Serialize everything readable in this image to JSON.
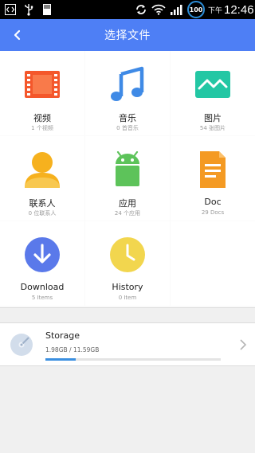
{
  "status_bar": {
    "battery_level": "100",
    "ampm": "下午",
    "time": "12:46",
    "icons": [
      "code-icon",
      "usb-icon",
      "sd-card-icon",
      "sync-icon",
      "wifi-icon",
      "signal-icon",
      "battery-icon"
    ]
  },
  "header": {
    "title": "选择文件",
    "back_icon": "back-arrow-icon",
    "color": "#4e7ff5"
  },
  "categories": [
    {
      "label": "视频",
      "count": "1 个视频",
      "icon": "video-icon",
      "color": "#f4572b"
    },
    {
      "label": "音乐",
      "count": "0 首音乐",
      "icon": "music-icon",
      "color": "#3f8ae6"
    },
    {
      "label": "图片",
      "count": "54 张图片",
      "icon": "image-icon",
      "color": "#23c7a4"
    },
    {
      "label": "联系人",
      "count": "0 位联系人",
      "icon": "contact-icon",
      "color": "#f6b11e"
    },
    {
      "label": "应用",
      "count": "24 个应用",
      "icon": "android-icon",
      "color": "#5dc35a"
    },
    {
      "label": "Doc",
      "count": "29 Docs",
      "icon": "document-icon",
      "color": "#f49a23"
    },
    {
      "label": "Download",
      "count": "5 Items",
      "icon": "download-icon",
      "color": "#5a79ea"
    },
    {
      "label": "History",
      "count": "0 Item",
      "icon": "clock-icon",
      "color": "#f2d64e"
    }
  ],
  "storage": {
    "name": "Storage",
    "size": "1.98GB / 11.59GB",
    "used_fraction": 0.171,
    "icon": "disk-icon",
    "chevron_icon": "chevron-right-icon",
    "bar_color": "#3a8fe0"
  }
}
